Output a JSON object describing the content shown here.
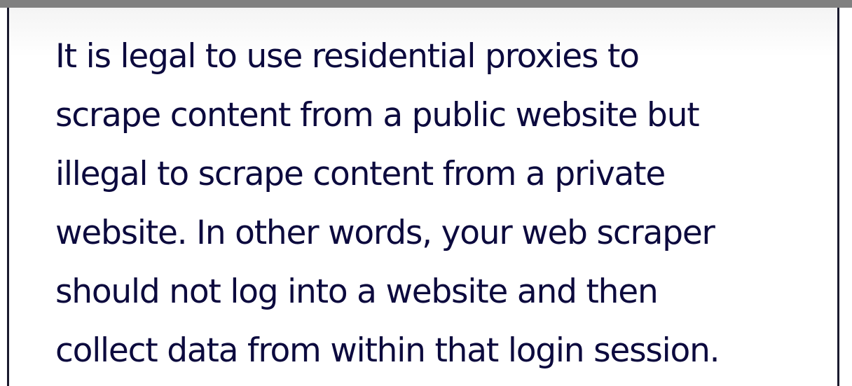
{
  "content": {
    "lines": [
      "It is legal to use residential proxies to",
      "scrape content from a public website but",
      "illegal to scrape content from a private",
      "website. In other words, your web scraper",
      "should not log into a website and then",
      "collect data from within that login session."
    ]
  },
  "colors": {
    "text": "#0c0a3e",
    "top_bar": "#808080",
    "border": "#1a1a2e"
  }
}
